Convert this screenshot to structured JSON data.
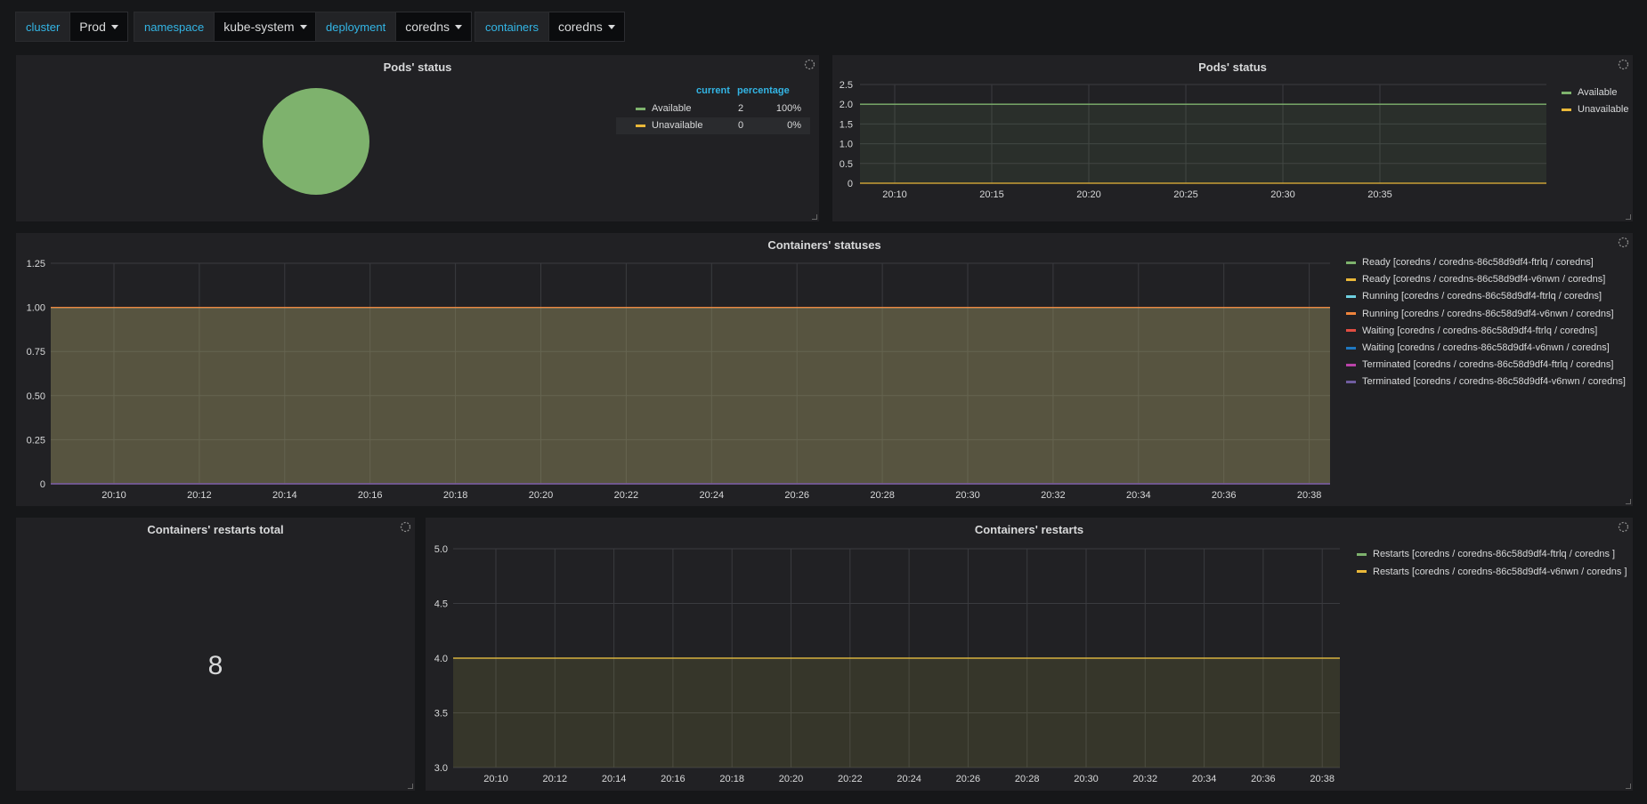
{
  "colors": {
    "available": "#7eb26d",
    "unavailable": "#eab839",
    "ready1": "#7eb26d",
    "ready2": "#eab839",
    "running1": "#6ed0e0",
    "running2": "#ef843c",
    "waiting1": "#e24d42",
    "waiting2": "#1f78c1",
    "terminated1": "#ba43a9",
    "terminated2": "#705da0",
    "restarts1": "#7eb26d",
    "restarts2": "#eab839"
  },
  "variables": [
    {
      "label": "cluster",
      "value": "Prod"
    },
    {
      "label": "namespace",
      "value": "kube-system"
    },
    {
      "label": "deployment",
      "value": "coredns"
    },
    {
      "label": "containers",
      "value": "coredns"
    }
  ],
  "pods_pie": {
    "title": "Pods' status",
    "headers": {
      "current": "current",
      "percentage": "percentage"
    },
    "rows": [
      {
        "name": "Available",
        "current": "2",
        "percentage": "100%"
      },
      {
        "name": "Unavailable",
        "current": "0",
        "percentage": "0%"
      }
    ]
  },
  "pods_graph": {
    "title": "Pods' status",
    "legend": [
      "Available",
      "Unavailable"
    ]
  },
  "containers_statuses": {
    "title": "Containers' statuses",
    "legend": [
      "Ready [coredns / coredns-86c58d9df4-ftrlq / coredns]",
      "Ready [coredns / coredns-86c58d9df4-v6nwn / coredns]",
      "Running [coredns / coredns-86c58d9df4-ftrlq / coredns]",
      "Running [coredns / coredns-86c58d9df4-v6nwn / coredns]",
      "Waiting [coredns / coredns-86c58d9df4-ftrlq / coredns]",
      "Waiting [coredns / coredns-86c58d9df4-v6nwn / coredns]",
      "Terminated [coredns / coredns-86c58d9df4-ftrlq / coredns]",
      "Terminated [coredns / coredns-86c58d9df4-v6nwn / coredns]"
    ]
  },
  "restarts_total": {
    "title": "Containers' restarts total",
    "value": "8"
  },
  "containers_restarts": {
    "title": "Containers' restarts",
    "legend": [
      "Restarts [coredns / coredns-86c58d9df4-ftrlq / coredns ]",
      "Restarts [coredns / coredns-86c58d9df4-v6nwn / coredns ]"
    ]
  },
  "chart_data": [
    {
      "type": "pie",
      "title": "Pods' status",
      "labels": [
        "Available",
        "Unavailable"
      ],
      "values": [
        2,
        0
      ]
    },
    {
      "type": "line",
      "title": "Pods' status",
      "x": [
        "20:10",
        "20:15",
        "20:20",
        "20:25",
        "20:30",
        "20:35"
      ],
      "yticks": [
        "0",
        "0.5",
        "1.0",
        "1.5",
        "2.0",
        "2.5"
      ],
      "ylim": [
        0,
        2.5
      ],
      "series": [
        {
          "name": "Available",
          "values": [
            2,
            2,
            2,
            2,
            2,
            2
          ]
        },
        {
          "name": "Unavailable",
          "values": [
            0,
            0,
            0,
            0,
            0,
            0
          ]
        }
      ],
      "legend_position": "right"
    },
    {
      "type": "area",
      "title": "Containers' statuses",
      "x": [
        "20:10",
        "20:12",
        "20:14",
        "20:16",
        "20:18",
        "20:20",
        "20:22",
        "20:24",
        "20:26",
        "20:28",
        "20:30",
        "20:32",
        "20:34",
        "20:36",
        "20:38"
      ],
      "yticks": [
        "0",
        "0.25",
        "0.50",
        "0.75",
        "1.00",
        "1.25"
      ],
      "ylim": [
        0,
        1.25
      ],
      "series": [
        {
          "name": "Ready [coredns / coredns-86c58d9df4-ftrlq / coredns]",
          "value": 1
        },
        {
          "name": "Ready [coredns / coredns-86c58d9df4-v6nwn / coredns]",
          "value": 1
        },
        {
          "name": "Running [coredns / coredns-86c58d9df4-ftrlq / coredns]",
          "value": 1
        },
        {
          "name": "Running [coredns / coredns-86c58d9df4-v6nwn / coredns]",
          "value": 1
        },
        {
          "name": "Waiting [coredns / coredns-86c58d9df4-ftrlq / coredns]",
          "value": 0
        },
        {
          "name": "Waiting [coredns / coredns-86c58d9df4-v6nwn / coredns]",
          "value": 0
        },
        {
          "name": "Terminated [coredns / coredns-86c58d9df4-ftrlq / coredns]",
          "value": 0
        },
        {
          "name": "Terminated [coredns / coredns-86c58d9df4-v6nwn / coredns]",
          "value": 0
        }
      ],
      "legend_position": "right"
    },
    {
      "type": "area",
      "title": "Containers' restarts",
      "x": [
        "20:10",
        "20:12",
        "20:14",
        "20:16",
        "20:18",
        "20:20",
        "20:22",
        "20:24",
        "20:26",
        "20:28",
        "20:30",
        "20:32",
        "20:34",
        "20:36",
        "20:38"
      ],
      "yticks": [
        "3.0",
        "3.5",
        "4.0",
        "4.5",
        "5.0"
      ],
      "ylim": [
        3,
        5
      ],
      "series": [
        {
          "name": "Restarts [coredns / coredns-86c58d9df4-ftrlq / coredns ]",
          "value": 4
        },
        {
          "name": "Restarts [coredns / coredns-86c58d9df4-v6nwn / coredns ]",
          "value": 4
        }
      ],
      "legend_position": "right"
    }
  ]
}
